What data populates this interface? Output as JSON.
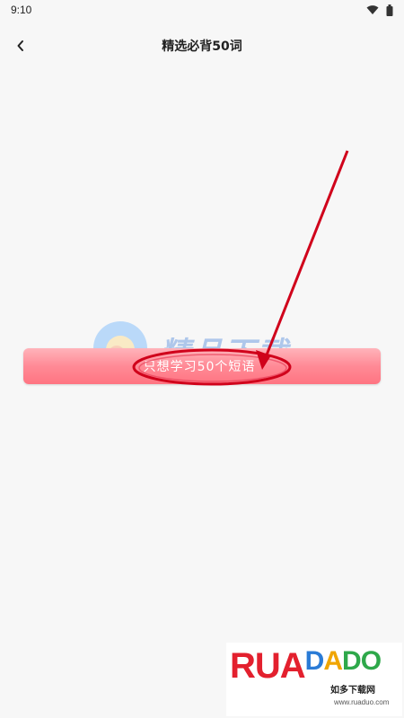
{
  "status_bar": {
    "time": "9:10"
  },
  "header": {
    "back_icon": "chevron-left-icon",
    "title": "精选必背50词"
  },
  "main": {
    "study_button_label": "只想学习50个短语"
  },
  "watermarks": {
    "center_logo_text": "精品下载",
    "brand_letters": [
      "R",
      "U",
      "A",
      "D",
      "A",
      "D",
      "O"
    ],
    "brand_subtitle": "如多下载网",
    "brand_url": "www.ruaduo.com"
  },
  "colors": {
    "button_gradient_top": "#ffb3ba",
    "button_gradient_bottom": "#ff7482",
    "annotation_red": "#d0021b",
    "background": "#f7f7f7"
  }
}
